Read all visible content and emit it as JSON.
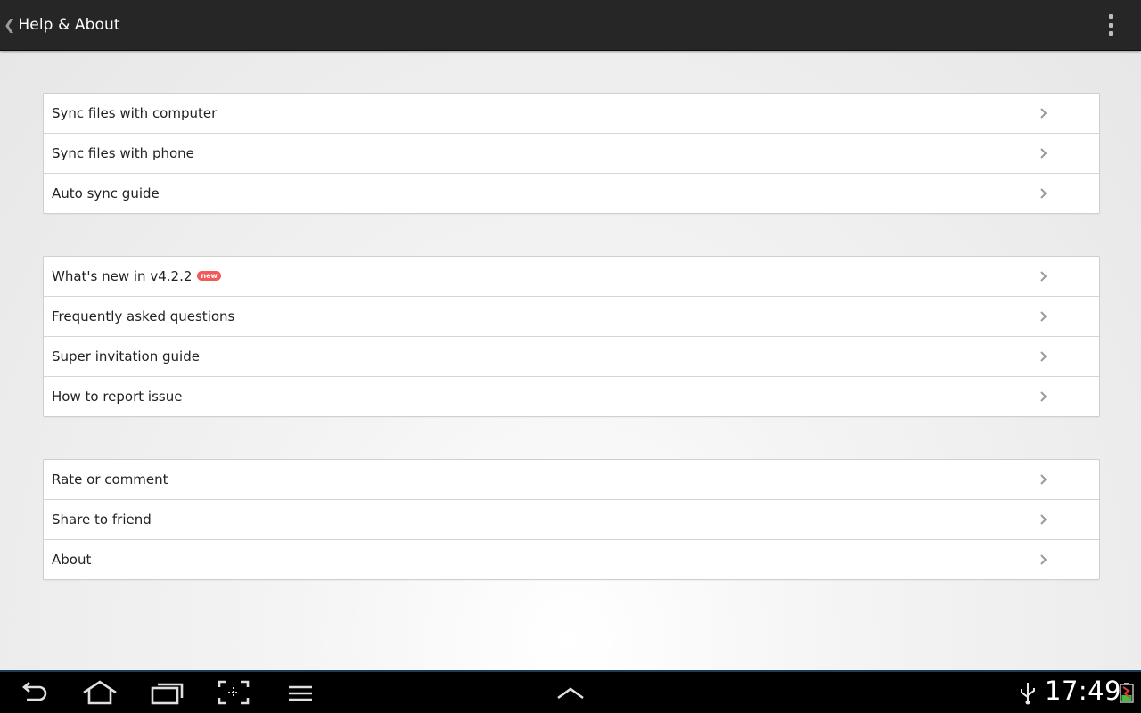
{
  "actionbar": {
    "title": "Help & About",
    "back_icon": "chevron-left-icon",
    "overflow_icon": "overflow-menu-icon"
  },
  "groups": [
    {
      "items": [
        {
          "label": "Sync files with computer"
        },
        {
          "label": "Sync files with phone"
        },
        {
          "label": "Auto sync guide"
        }
      ]
    },
    {
      "items": [
        {
          "label": "What's new in v4.2.2",
          "badge": "new"
        },
        {
          "label": "Frequently asked questions"
        },
        {
          "label": "Super invitation guide"
        },
        {
          "label": "How to report issue"
        }
      ]
    },
    {
      "items": [
        {
          "label": "Rate or comment"
        },
        {
          "label": "Share to friend"
        },
        {
          "label": "About"
        }
      ]
    }
  ],
  "system_bar": {
    "time": "17:49",
    "icons": [
      "back-icon",
      "home-icon",
      "recent-apps-icon",
      "screenshot-icon",
      "menu-icon",
      "chevron-up-icon",
      "usb-icon",
      "battery-icon"
    ]
  },
  "colors": {
    "actionbar_bg": "#262626",
    "badge_bg": "#f25a5a",
    "navbar_accent": "#1f3b5a"
  }
}
